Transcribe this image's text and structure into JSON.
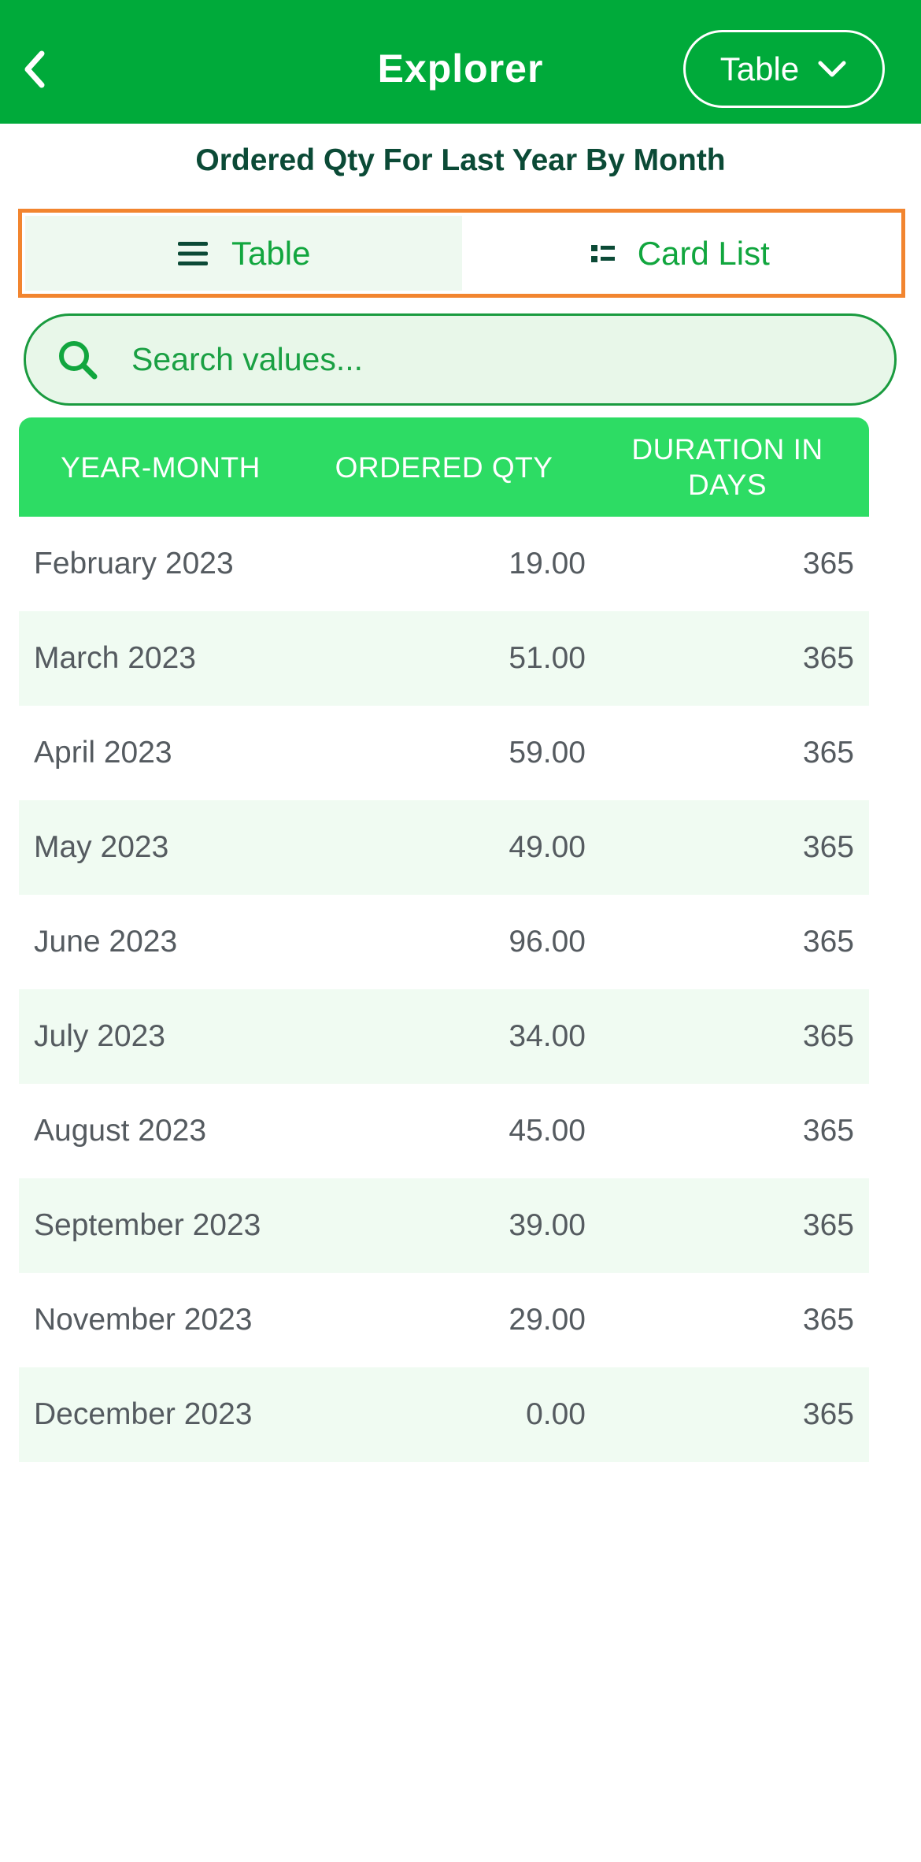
{
  "header": {
    "title": "Explorer",
    "view_select": {
      "selected": "Table"
    }
  },
  "page_title": "Ordered Qty For Last Year By Month",
  "segments": [
    {
      "label": "Table",
      "active": true
    },
    {
      "label": "Card List",
      "active": false
    }
  ],
  "search": {
    "placeholder": "Search values..."
  },
  "table": {
    "columns": [
      "YEAR-MONTH",
      "ORDERED QTY",
      "DURATION IN DAYS"
    ],
    "rows": [
      [
        "February 2023",
        "19.00",
        "365"
      ],
      [
        "March 2023",
        "51.00",
        "365"
      ],
      [
        "April 2023",
        "59.00",
        "365"
      ],
      [
        "May 2023",
        "49.00",
        "365"
      ],
      [
        "June 2023",
        "96.00",
        "365"
      ],
      [
        "July 2023",
        "34.00",
        "365"
      ],
      [
        "August 2023",
        "45.00",
        "365"
      ],
      [
        "September 2023",
        "39.00",
        "365"
      ],
      [
        "November 2023",
        "29.00",
        "365"
      ],
      [
        "December 2023",
        "0.00",
        "365"
      ]
    ]
  },
  "colors": {
    "header_bg": "#00aa3a",
    "table_header_bg": "#2ddc64",
    "segment_border": "#f2852f",
    "accent_green": "#11a63e",
    "title_dark_green": "#0b4a36"
  },
  "icons": {
    "back": "chevron-left-icon",
    "dropdown": "chevron-down-icon",
    "table": "menu-lines-icon",
    "card_list": "list-icon",
    "search": "search-icon"
  }
}
